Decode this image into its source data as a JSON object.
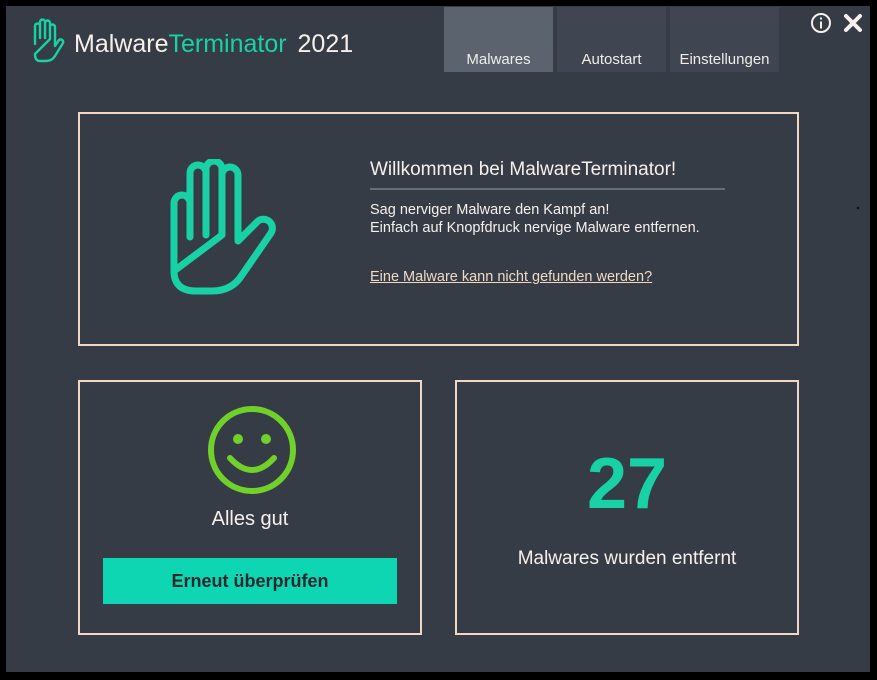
{
  "header": {
    "title_part1": "Malware",
    "title_part2": "Terminator",
    "title_year": "2021",
    "logo_icon": "hand-stop-icon",
    "accent_color": "#18d2a6"
  },
  "tabs": [
    {
      "label": "Malwares",
      "active": true
    },
    {
      "label": "Autostart",
      "active": false
    },
    {
      "label": "Einstellungen",
      "active": false
    }
  ],
  "window_controls": {
    "info_icon": "info-icon",
    "close_icon": "close-icon"
  },
  "welcome": {
    "title": "Willkommen bei MalwareTerminator!",
    "line1": "Sag nerviger Malware den Kampf an!",
    "line2": "Einfach auf Knopfdruck nervige Malware entfernen.",
    "link": "Eine Malware kann nicht gefunden werden?",
    "icon": "hand-stop-icon"
  },
  "status": {
    "icon": "smiley-icon",
    "text": "Alles gut",
    "button_label": "Erneut überprüfen",
    "smiley_color": "#6fd12a",
    "button_color": "#0fd6b2"
  },
  "stats": {
    "count": "27",
    "label": "Malwares wurden entfernt"
  }
}
